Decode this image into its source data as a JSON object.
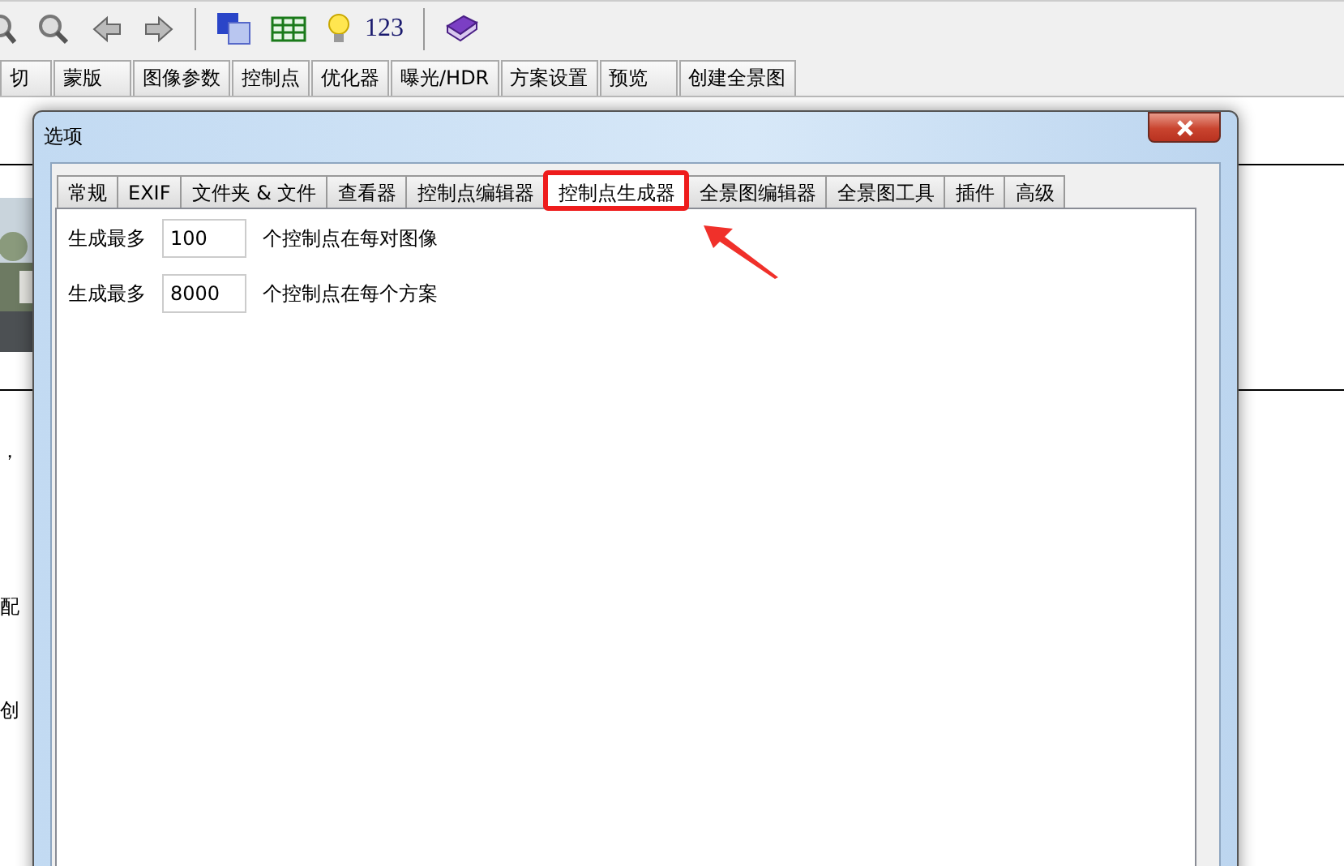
{
  "background_app": {
    "toolbar": {
      "counter_label": "123"
    },
    "tabs": [
      "切",
      "蒙版",
      "图像参数",
      "控制点",
      "优化器",
      "曝光/HDR",
      "方案设置",
      "预览",
      "创建全景图"
    ],
    "text_fragments": [
      "，",
      "配",
      "创"
    ]
  },
  "dialog": {
    "title": "选项",
    "tabs": [
      {
        "label": "常规",
        "selected": false
      },
      {
        "label": "EXIF",
        "selected": false
      },
      {
        "label": "文件夹 & 文件",
        "selected": false
      },
      {
        "label": "查看器",
        "selected": false
      },
      {
        "label": "控制点编辑器",
        "selected": false
      },
      {
        "label": "控制点生成器",
        "selected": true
      },
      {
        "label": "全景图编辑器",
        "selected": false
      },
      {
        "label": "全景图工具",
        "selected": false
      },
      {
        "label": "插件",
        "selected": false
      },
      {
        "label": "高级",
        "selected": false
      }
    ],
    "rows": [
      {
        "label": "生成最多",
        "value": "100",
        "suffix": "个控制点在每对图像"
      },
      {
        "label": "生成最多",
        "value": "8000",
        "suffix": "个控制点在每个方案"
      }
    ]
  }
}
